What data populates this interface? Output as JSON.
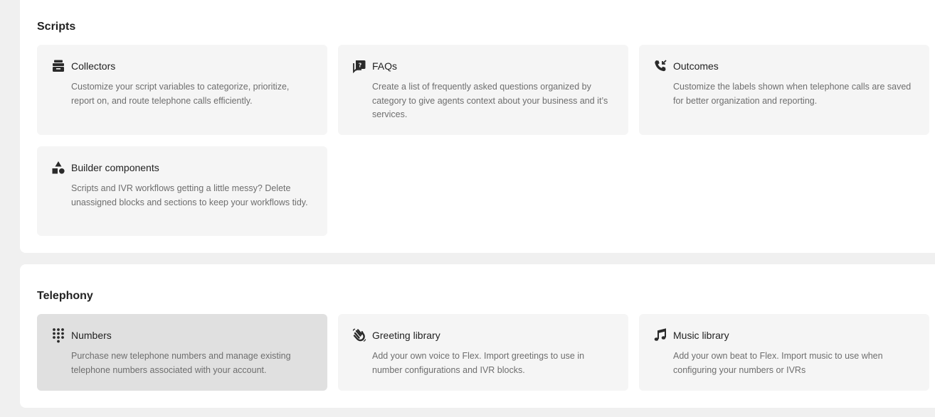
{
  "scripts": {
    "title": "Scripts",
    "cards": [
      {
        "icon": "archive-box-icon",
        "title": "Collectors",
        "description": "Customize your script variables to categorize, prioritize, report on, and route telephone calls efficiently."
      },
      {
        "icon": "chat-question-icon",
        "title": "FAQs",
        "description": "Create a list of frequently asked questions organized by category to give agents context about your business and it’s services."
      },
      {
        "icon": "phone-incoming-icon",
        "title": "Outcomes",
        "description": "Customize the labels shown when telephone calls are saved for better organization and reporting."
      },
      {
        "icon": "shapes-icon",
        "title": "Builder components",
        "description": "Scripts and IVR workflows getting a little messy? Delete unassigned blocks and sections to keep your workflows tidy."
      }
    ]
  },
  "telephony": {
    "title": "Telephony",
    "cards": [
      {
        "icon": "dialpad-icon",
        "title": "Numbers",
        "description": "Purchase new telephone numbers and manage existing telephone numbers associated with your account."
      },
      {
        "icon": "waving-hand-icon",
        "title": "Greeting library",
        "description": "Add your own voice to Flex. Import greetings to use in number configurations and IVR blocks."
      },
      {
        "icon": "music-note-icon",
        "title": "Music library",
        "description": "Add your own beat to Flex. Import music to use when configuring your numbers or IVRs"
      }
    ]
  }
}
